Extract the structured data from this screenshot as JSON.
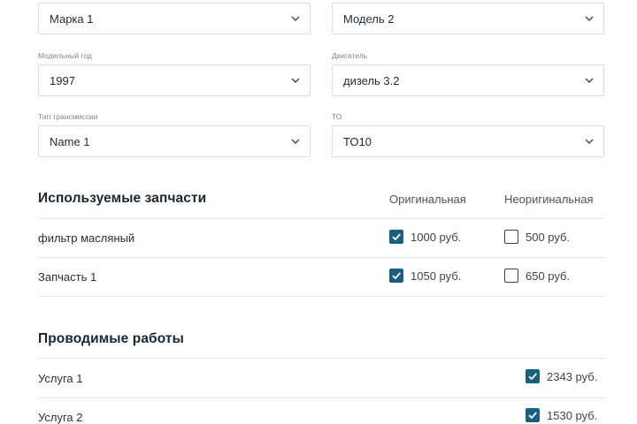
{
  "filters": {
    "brand": {
      "label": "",
      "value": "Марка 1"
    },
    "model": {
      "label": "",
      "value": "Модель 2"
    },
    "year": {
      "label": "Модельный год",
      "value": "1997"
    },
    "engine": {
      "label": "Двигатель",
      "value": "дизель 3.2"
    },
    "transmission": {
      "label": "Тип трансмиссии",
      "value": "Name 1"
    },
    "service": {
      "label": "ТО",
      "value": "ТО10"
    }
  },
  "parts": {
    "title": "Используемые запчасти",
    "col_original": "Оригинальная",
    "col_nonoriginal": "Неоригинальная",
    "rows": [
      {
        "name": "фильтр масляный",
        "original_price": "1000 руб.",
        "original_checked": true,
        "nonoriginal_price": "500 руб.",
        "nonoriginal_checked": false
      },
      {
        "name": "Запчасть 1",
        "original_price": "1050 руб.",
        "original_checked": true,
        "nonoriginal_price": "650 руб.",
        "nonoriginal_checked": false
      }
    ]
  },
  "works": {
    "title": "Проводимые работы",
    "rows": [
      {
        "name": "Услуга 1",
        "price": "2343 руб.",
        "checked": true
      },
      {
        "name": "Услуга 2",
        "price": "1530 руб.",
        "checked": true
      }
    ]
  },
  "colors": {
    "accent": "#1b5f7e",
    "border": "#d8dde2",
    "text": "#1e2a33"
  }
}
